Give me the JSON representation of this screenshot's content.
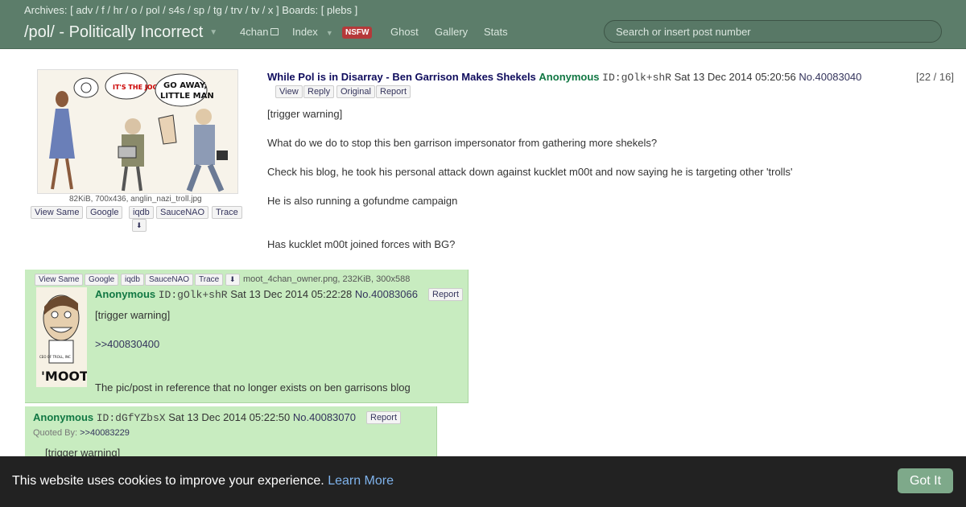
{
  "header": {
    "archives_label": "Archives:",
    "archives_open": "[",
    "archives": [
      "adv",
      "f",
      "hr",
      "o",
      "pol",
      "s4s",
      "sp",
      "tg",
      "trv",
      "tv",
      "x"
    ],
    "archives_close": "]",
    "boards_label": "Boards:",
    "boards": [
      "plebs"
    ],
    "board_title": "/pol/ - Politically Incorrect",
    "nav_4chan": "4chan",
    "nav_index": "Index",
    "nsfw_badge": "NSFW",
    "nav_ghost": "Ghost",
    "nav_gallery": "Gallery",
    "nav_stats": "Stats",
    "search_placeholder": "Search or insert post number"
  },
  "op": {
    "subject": "While Pol is in Disarray - Ben Garrison Makes Shekels",
    "name": "Anonymous",
    "poster_id": "ID:gOlk+shR",
    "date": "Sat 13 Dec 2014 05:20:56",
    "no_prefix": "No.",
    "post_no": "40083040",
    "counter": "[22 / 16]",
    "actions": [
      "View",
      "Reply",
      "Original",
      "Report"
    ],
    "file_info": "82KiB, 700x436, anglin_nazi_troll.jpg",
    "image_buttons": [
      "View Same",
      "Google",
      "iqdb",
      "SauceNAO",
      "Trace"
    ],
    "thumb_texts": [
      "GO AWAY,",
      "LITTLE MAN",
      "IT'S THE JOOS!"
    ],
    "body": [
      "[trigger warning]",
      "What do we do to stop this ben garrison impersonator from gathering more shekels?",
      "Check his blog, he took his personal attack down against kucklet m00t and now saying he is targeting other 'trolls'",
      "He is also running a gofundme campaign",
      "Has kucklet m00t joined forces with BG?"
    ]
  },
  "reply1": {
    "image_buttons": [
      "View Same",
      "Google",
      "iqdb",
      "SauceNAO",
      "Trace"
    ],
    "file_info": "moot_4chan_owner.png, 232KiB, 300x588",
    "name": "Anonymous",
    "poster_id": "ID:gOlk+shR",
    "date": "Sat 13 Dec 2014 05:22:28",
    "no_prefix": "No.",
    "post_no": "40083066",
    "report": "Report",
    "thumb_caption": "'MOOT'",
    "thumb_small": "CEO OF TROLL, INC",
    "body": [
      "[trigger warning]",
      ">>400830400",
      "The pic/post in reference that no longer exists on ben garrisons blog"
    ]
  },
  "reply2": {
    "name": "Anonymous",
    "poster_id": "ID:dGfYZbsX",
    "date": "Sat 13 Dec 2014 05:22:50",
    "no_prefix": "No.",
    "post_no": "40083070",
    "report": "Report",
    "quoted_by_label": "Quoted By:",
    "quoted_by": ">>40083229",
    "body": [
      "[trigger warning]"
    ]
  },
  "cookie": {
    "text": "This website uses cookies to improve your experience.",
    "learn_more": "Learn More",
    "button": "Got It"
  },
  "colors": {
    "header_bg": "#5c7d6a",
    "reply_bg": "#c8ecc0",
    "name_green": "#117743",
    "subject_blue": "#0f0c5d",
    "nsfw_red": "#b5393a",
    "cookie_bg": "#222222",
    "got_it_bg": "#7ea98a"
  }
}
